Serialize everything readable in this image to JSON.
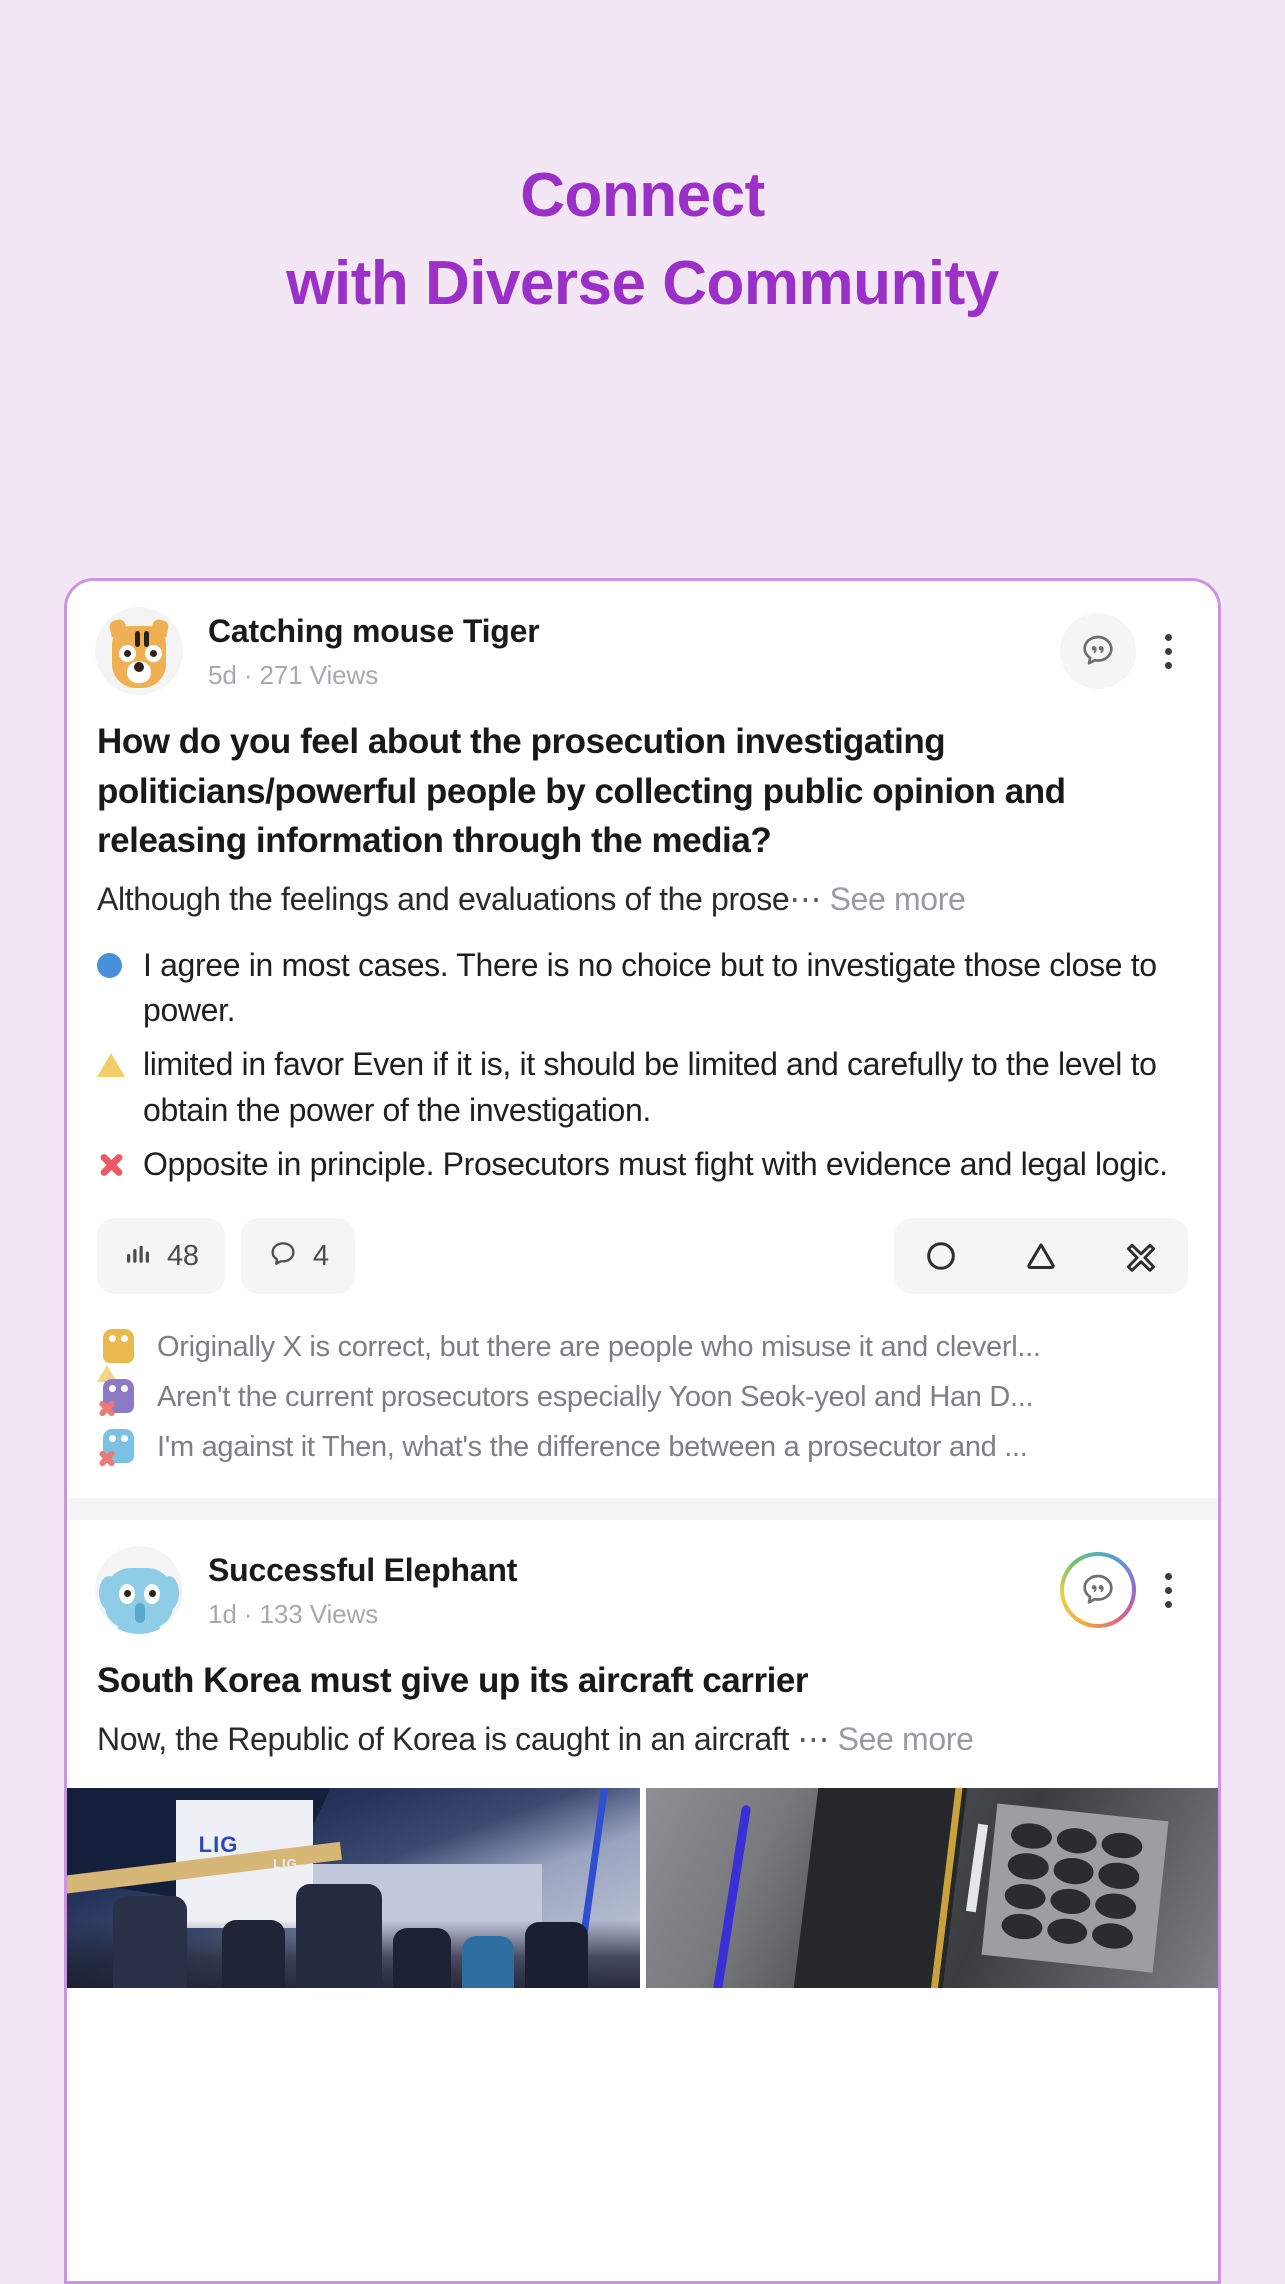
{
  "hero": {
    "line1": "Connect",
    "line2": "with Diverse Community",
    "accent_color": "#9b30c9"
  },
  "page": {
    "background_color": "#f3e7f5",
    "card_border_color": "#cb93e0"
  },
  "posts": [
    {
      "author": "Catching mouse Tiger",
      "avatar_icon": "tiger-avatar",
      "meta": "5d · 271 Views",
      "bubble_icon": "quote-bubble-icon",
      "menu_icon": "kebab-menu-icon",
      "title": "How do you feel about the prosecution investigating politicians/powerful people by collecting public opinion and releasing information through the media?",
      "excerpt": "Although the feelings and evaluations of the prose",
      "excerpt_ellipsis": "⋯",
      "see_more": "See more",
      "poll": [
        {
          "mark": "circle-blue",
          "mark_color": "#4a90d9",
          "text": "I agree in most cases. There is no choice but to investigate those close to power."
        },
        {
          "mark": "triangle-yellow",
          "mark_color": "#f2ce6b",
          "text": "limited in favor Even if it is, it should be limited and carefully to the level to obtain the power of the investigation."
        },
        {
          "mark": "x-red",
          "mark_color": "#eb5a62",
          "text": "Opposite in principle. Prosecutors must fight with evidence and legal logic."
        }
      ],
      "actions": {
        "stats_icon": "bar-chart-icon",
        "stats_count": "48",
        "comments_icon": "speech-bubble-icon",
        "comments_count": "4",
        "vote_circle_icon": "vote-circle-icon",
        "vote_triangle_icon": "vote-triangle-icon",
        "vote_x_icon": "vote-x-icon"
      },
      "comments": [
        {
          "avatar_color": "#e9b94e",
          "badge": "triangle",
          "text": "Originally X is correct, but there are people who misuse it and cleverl..."
        },
        {
          "avatar_color": "#8d7ac4",
          "badge": "x",
          "text": "Aren't the current prosecutors especially Yoon Seok-yeol and Han D..."
        },
        {
          "avatar_color": "#7cc1e3",
          "badge": "x",
          "text": "I'm against it Then, what's the difference between a prosecutor and ..."
        }
      ]
    },
    {
      "author": "Successful Elephant",
      "avatar_icon": "elephant-avatar",
      "meta": "1d · 133 Views",
      "bubble_icon": "quote-bubble-icon",
      "menu_icon": "kebab-menu-icon",
      "title": "South Korea must give up its aircraft carrier",
      "excerpt": "Now, the Republic of Korea is caught in an aircraft",
      "excerpt_ellipsis": "⋯",
      "see_more": "See more",
      "photos": [
        {
          "name": "trade-show-booth-photo",
          "logo_text": "LIG"
        },
        {
          "name": "industrial-equipment-photo"
        }
      ]
    }
  ]
}
